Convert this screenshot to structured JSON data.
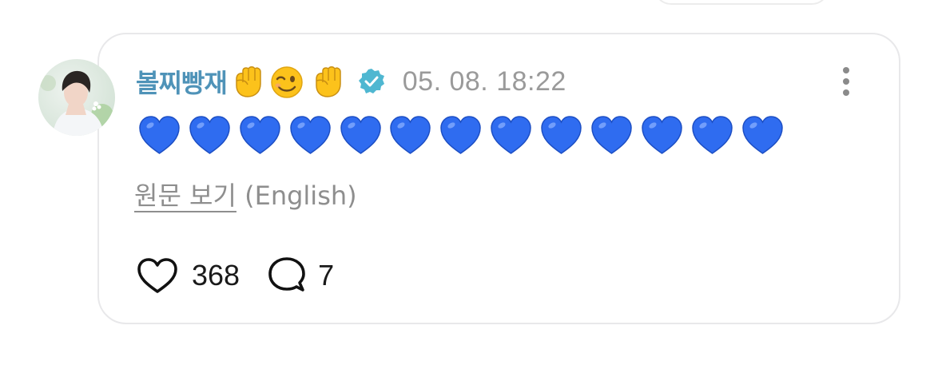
{
  "comment": {
    "username": "볼찌빵재",
    "username_emojis": [
      "raised-fist",
      "winking-face",
      "raised-fist"
    ],
    "verified": true,
    "timestamp": "05. 08. 18:22",
    "body_emojis": [
      "blue-heart",
      "blue-heart",
      "blue-heart",
      "blue-heart",
      "blue-heart",
      "blue-heart",
      "blue-heart",
      "blue-heart",
      "blue-heart",
      "blue-heart",
      "blue-heart",
      "blue-heart",
      "blue-heart"
    ],
    "translate_link": "원문 보기",
    "translate_language": "(English)",
    "likes": "368",
    "replies": "7"
  },
  "colors": {
    "username": "#4f93b8",
    "verified_badge": "#4fb7d1",
    "timestamp": "#9a9a9a",
    "heart": "#2f6cf0",
    "card_border": "#e8e8ea"
  },
  "icons": {
    "more": "more-vertical-icon",
    "like": "heart-outline-icon",
    "reply": "speech-bubble-icon",
    "verified": "verified-badge-icon"
  }
}
